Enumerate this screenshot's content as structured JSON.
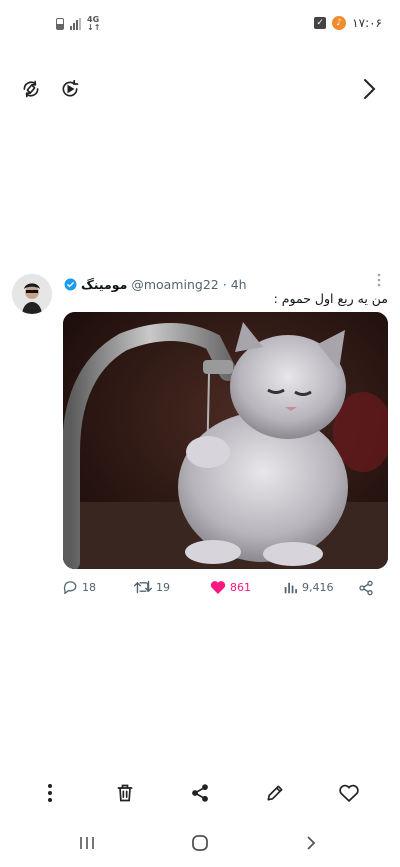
{
  "status_bar": {
    "time": "۱۷:۰۶",
    "network": "4G",
    "icons": [
      "battery-icon",
      "signal-icon",
      "network-4g-icon",
      "checkbox-notification-icon",
      "music-app-icon"
    ]
  },
  "toolbar": {
    "icons": [
      "auto-rotate-icon",
      "motion-photo-play-icon",
      "chevron-right-icon"
    ]
  },
  "tweet": {
    "display_name": "مومینگ",
    "handle": "@moaming22",
    "separator": "·",
    "time": "4h",
    "text": "من یه ربع اول حموم :",
    "media_description_icon": "cat-drinking-faucet-image",
    "actions": {
      "replies": "18",
      "retweets": "19",
      "likes": "861",
      "views": "9,416"
    },
    "colors": {
      "like": "#f91880",
      "verified": "#1d9bf0",
      "meta": "#536471"
    }
  },
  "bottom_toolbar": {
    "icons": [
      "more-vertical-icon",
      "trash-icon",
      "share-icon",
      "edit-pencil-icon",
      "heart-outline-icon"
    ]
  },
  "nav_bar": {
    "icons": [
      "recent-apps-icon",
      "home-icon",
      "back-icon"
    ]
  }
}
